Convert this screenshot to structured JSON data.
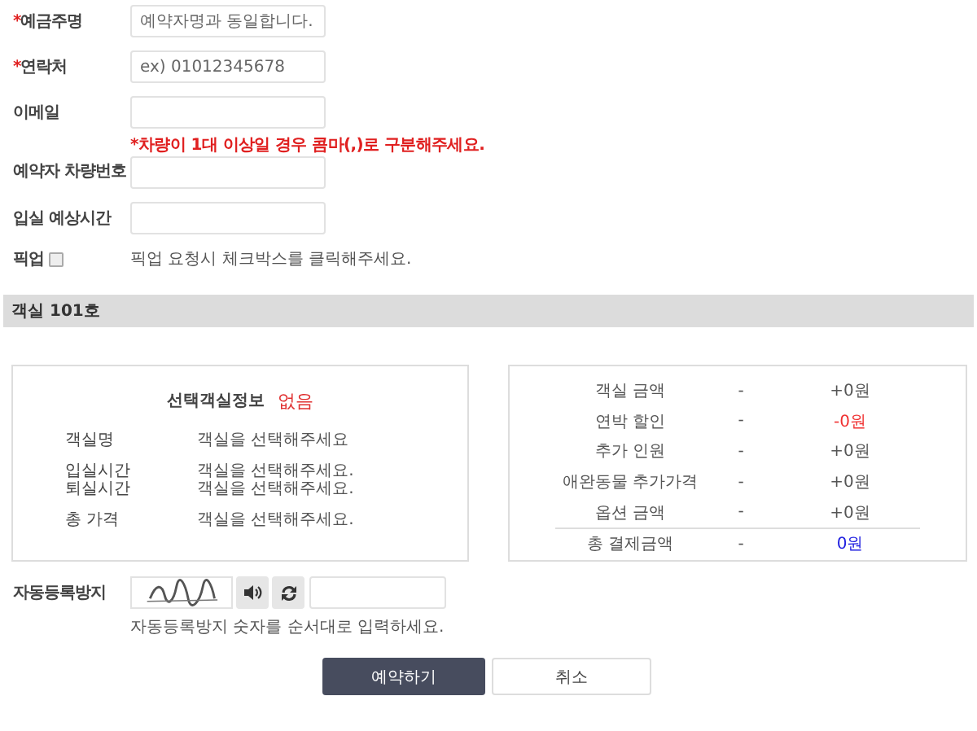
{
  "form": {
    "fields": [
      {
        "label": "예금주명",
        "mark": "*",
        "placeholder": "예약자명과 동일합니다."
      },
      {
        "label": "연락처",
        "mark": "*",
        "placeholder": "ex) 01012345678"
      },
      {
        "label": "이메일"
      },
      {
        "label": "예약자 차량번호",
        "hint": "*차량이 1대 이상일 경우 콤마(,)로 구분해주세요."
      },
      {
        "label": "입실 예상시간"
      }
    ],
    "pickup": {
      "label": "픽업",
      "checked": false,
      "note": "픽업 요청시 체크박스를 클릭해주세요."
    }
  },
  "section_title": "객실 101호",
  "selected_room": {
    "title": "선택객실정보",
    "status": "없음",
    "groups": [
      [
        {
          "label": "객실명",
          "value": "객실을 선택해주세요"
        }
      ],
      [
        {
          "label": "입실시간",
          "value": "객실을 선택해주세요."
        },
        {
          "label": "퇴실시간",
          "value": "객실을 선택해주세요."
        }
      ],
      [
        {
          "label": "총 가격",
          "value": "객실을 선택해주세요."
        }
      ]
    ]
  },
  "price_summary": {
    "rows": [
      {
        "label": "객실 금액",
        "dash": "-",
        "amount": "+0원",
        "kind": "normal"
      },
      {
        "label": "연박 할인",
        "dash": "-",
        "amount": "-0원",
        "kind": "discount"
      },
      {
        "label": "추가 인원",
        "dash": "-",
        "amount": "+0원",
        "kind": "normal"
      },
      {
        "label": "애완동물 추가가격",
        "dash": "-",
        "amount": "+0원",
        "kind": "normal"
      },
      {
        "label": "옵션 금액",
        "dash": "-",
        "amount": "+0원",
        "kind": "normal"
      },
      {
        "label": "총 결제금액",
        "dash": "-",
        "amount": "0원",
        "kind": "total"
      }
    ]
  },
  "captcha": {
    "label": "자동등록방지",
    "hint": "자동등록방지 숫자를 순서대로 입력하세요."
  },
  "buttons": [
    {
      "label": "예약하기",
      "kind": "primary"
    },
    {
      "label": "취소",
      "kind": "secondary"
    }
  ]
}
